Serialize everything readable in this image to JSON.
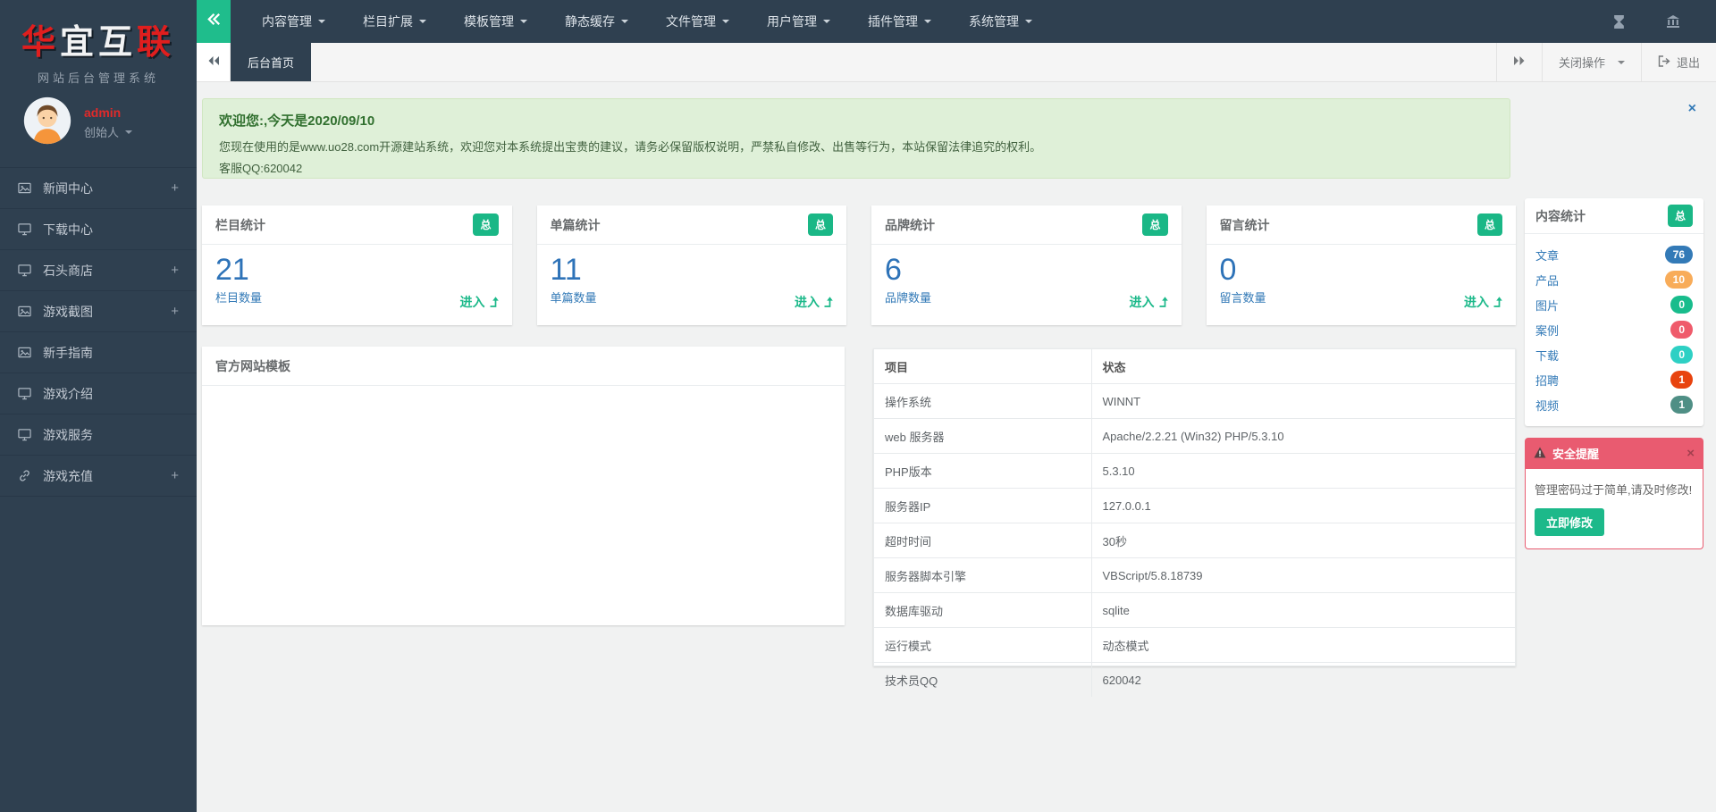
{
  "brand": {
    "logo": [
      {
        "char": "华",
        "color": "#e01e1e"
      },
      {
        "char": "宜",
        "color": "#f2f3f4"
      },
      {
        "char": "互",
        "color": "#f2f3f4"
      },
      {
        "char": "联",
        "color": "#e01e1e"
      }
    ],
    "subtitle": "网站后台管理系统",
    "username": "admin",
    "role": "创始人"
  },
  "topnav": {
    "items": [
      "内容管理",
      "栏目扩展",
      "模板管理",
      "静态缓存",
      "文件管理",
      "用户管理",
      "插件管理",
      "系统管理"
    ],
    "right_icons": [
      "hourglass-icon",
      "bank-icon"
    ]
  },
  "sidebar": {
    "items": [
      {
        "label": "新闻中心",
        "icon": "image-icon",
        "expandable": true
      },
      {
        "label": "下载中心",
        "icon": "monitor-icon",
        "expandable": false
      },
      {
        "label": "石头商店",
        "icon": "monitor-icon",
        "expandable": true
      },
      {
        "label": "游戏截图",
        "icon": "image-icon",
        "expandable": true
      },
      {
        "label": "新手指南",
        "icon": "image-icon",
        "expandable": false
      },
      {
        "label": "游戏介绍",
        "icon": "monitor-icon",
        "expandable": false
      },
      {
        "label": "游戏服务",
        "icon": "monitor-icon",
        "expandable": false
      },
      {
        "label": "游戏充值",
        "icon": "link-icon",
        "expandable": true
      }
    ]
  },
  "tabbar": {
    "active_tab": "后台首页",
    "close_menu": "关闭操作",
    "logout": "退出"
  },
  "welcome": {
    "title": "欢迎您:,今天是2020/09/10",
    "body": "您现在使用的是www.uo28.com开源建站系统，欢迎您对本系统提出宝贵的建议，请务必保留版权说明，严禁私自修改、出售等行为，本站保留法律追究的权利。",
    "service": "客服QQ:620042"
  },
  "stat_cards": [
    {
      "title": "栏目统计",
      "badge": "总",
      "value": "21",
      "label": "栏目数量",
      "link": "进入"
    },
    {
      "title": "单篇统计",
      "badge": "总",
      "value": "11",
      "label": "单篇数量",
      "link": "进入"
    },
    {
      "title": "品牌统计",
      "badge": "总",
      "value": "6",
      "label": "品牌数量",
      "link": "进入"
    },
    {
      "title": "留言统计",
      "badge": "总",
      "value": "0",
      "label": "留言数量",
      "link": "进入"
    }
  ],
  "template_panel": {
    "title": "官方网站模板"
  },
  "server_table": {
    "headers": [
      "项目",
      "状态"
    ],
    "rows": [
      [
        "操作系统",
        "WINNT"
      ],
      [
        "web 服务器",
        "Apache/2.2.21 (Win32) PHP/5.3.10"
      ],
      [
        "PHP版本",
        "5.3.10"
      ],
      [
        "服务器IP",
        "127.0.0.1"
      ],
      [
        "超时时间",
        "30秒"
      ],
      [
        "服务器脚本引擎",
        "VBScript/5.8.18739"
      ],
      [
        "数据库驱动",
        "sqlite"
      ],
      [
        "运行模式",
        "动态模式"
      ],
      [
        "技术员QQ",
        "620042"
      ]
    ]
  },
  "content_stats": {
    "title": "内容统计",
    "badge": "总",
    "items": [
      {
        "label": "文章",
        "count": "76",
        "color": "#337ab7"
      },
      {
        "label": "产品",
        "count": "10",
        "color": "#f8ac59"
      },
      {
        "label": "图片",
        "count": "0",
        "color": "#18bc8c"
      },
      {
        "label": "案例",
        "count": "0",
        "color": "#ef5b6b"
      },
      {
        "label": "下载",
        "count": "0",
        "color": "#2ed0c4"
      },
      {
        "label": "招聘",
        "count": "1",
        "color": "#e8430e"
      },
      {
        "label": "视频",
        "count": "1",
        "color": "#4f8f85"
      }
    ]
  },
  "security_alert": {
    "title": "安全提醒",
    "message": "管理密码过于简单,请及时修改!",
    "button": "立即修改",
    "header_color": "#e95b70"
  },
  "glyphs": {
    "close": "×",
    "plus": "+"
  },
  "colors": {
    "dark": "#2f4050",
    "green": "#1cb98a",
    "blue": "#337ab7",
    "content_bg": "#f1f2f2"
  }
}
